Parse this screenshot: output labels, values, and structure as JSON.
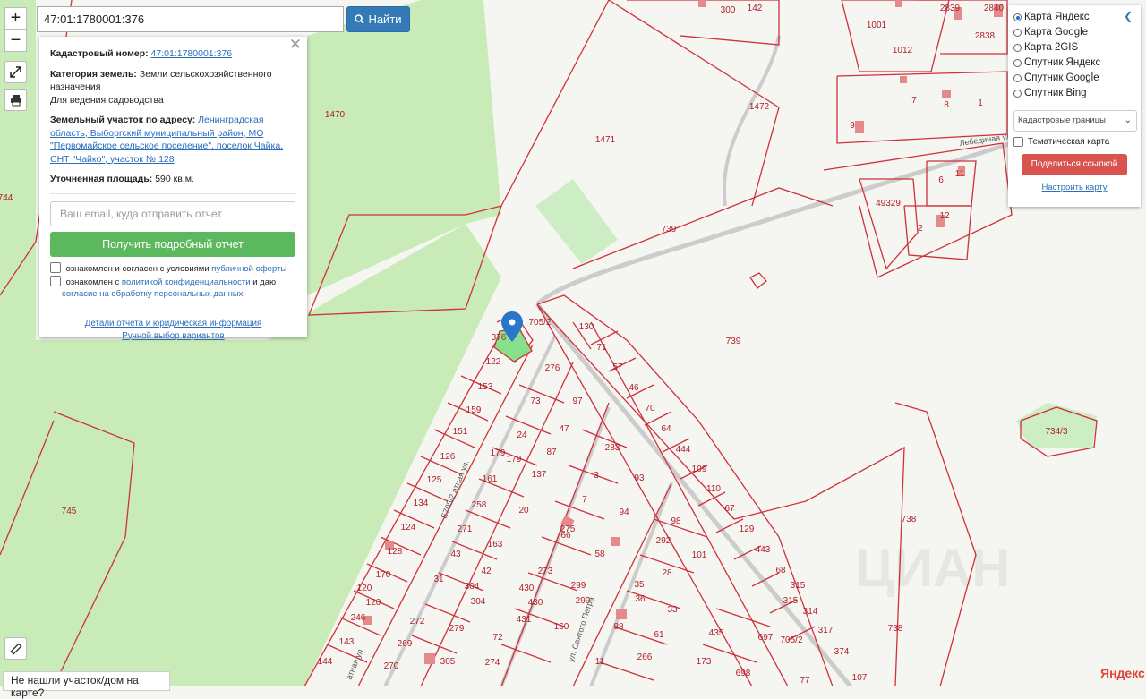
{
  "search": {
    "value": "47:01:1780001:376",
    "button_label": "Найти"
  },
  "zoom": {
    "in_label": "+",
    "out_label": "−"
  },
  "info": {
    "cadastral_label": "Кадастровый номер:",
    "cadastral_value": "47:01:1780001:376",
    "category_label": "Категория земель:",
    "category_value": "Земли сельскохозяйственного назначения",
    "use_value": "Для ведения садоводства",
    "address_label": "Земельный участок по адресу:",
    "address_value": "Ленинградская область, Выборгский муниципальный район, МО \"Первомайское сельское поселение\", поселок Чайка, СНТ \"Чайко\", участок № 128",
    "area_label": "Уточненная площадь:",
    "area_value": "590 кв.м.",
    "email_placeholder": "Ваш email, куда отправить отчет",
    "report_button": "Получить подробный отчет",
    "agree1_prefix": "ознакомлен и согласен с условиями",
    "agree1_link": "публичной оферты",
    "agree2_prefix": "ознакомлен с",
    "agree2_link": "политикой конфиденциальности",
    "agree2_mid": "и даю",
    "agree2_link2": "согласие на обработку персональных данных",
    "details_link": "Детали отчета и юридическая информация",
    "manual_link": "Ручной выбор вариантов"
  },
  "layers": {
    "options": [
      "Карта Яндекс",
      "Карта Google",
      "Карта 2GIS",
      "Спутник Яндекс",
      "Спутник Google",
      "Спутник Bing"
    ],
    "selected": "Карта Яндекс",
    "select_value": "Кадастровые границы",
    "thematic_label": "Тематическая карта",
    "share_button": "Поделиться ссылкой",
    "tune_link": "Настроить карту"
  },
  "map": {
    "plot_labels": [
      "1470",
      "1471",
      "1472",
      "739",
      "739",
      "745",
      "744",
      "738",
      "738",
      "734/3",
      "705/2",
      "705/2",
      "376",
      "130",
      "71",
      "57",
      "46",
      "70",
      "64",
      "444",
      "109",
      "110",
      "67",
      "129",
      "443",
      "68",
      "315",
      "315",
      "314",
      "317",
      "374",
      "107",
      "697",
      "698",
      "435",
      "173",
      "276",
      "73",
      "97",
      "47",
      "24",
      "87",
      "179",
      "179",
      "137",
      "161",
      "20",
      "258",
      "271",
      "163",
      "43",
      "42",
      "304",
      "304",
      "31",
      "279",
      "272",
      "269",
      "305",
      "270",
      "274",
      "72",
      "283",
      "93",
      "3",
      "7",
      "94",
      "275",
      "66",
      "58",
      "273",
      "299",
      "299",
      "430",
      "430",
      "431",
      "160",
      "88",
      "61",
      "11",
      "266",
      "35",
      "36",
      "33",
      "28",
      "101",
      "292",
      "98",
      "122",
      "153",
      "159",
      "151",
      "126",
      "125",
      "134",
      "124",
      "128",
      "170",
      "120",
      "120",
      "246",
      "143",
      "144",
      "1001",
      "1012",
      "300",
      "142",
      "2839",
      "2840",
      "2838",
      "7",
      "8",
      "1",
      "9",
      "6",
      "11",
      "49329",
      "2",
      "12",
      "77"
    ],
    "street_labels": [
      "Лебединая ул.",
      "ул. Святого Петра",
      "Е705/2 атная ул.",
      "атная ул."
    ],
    "watermark": "ЦИАН"
  },
  "bottom": {
    "not_found": "Не нашли участок/дом на карте?",
    "yandex": "Яндекс"
  }
}
